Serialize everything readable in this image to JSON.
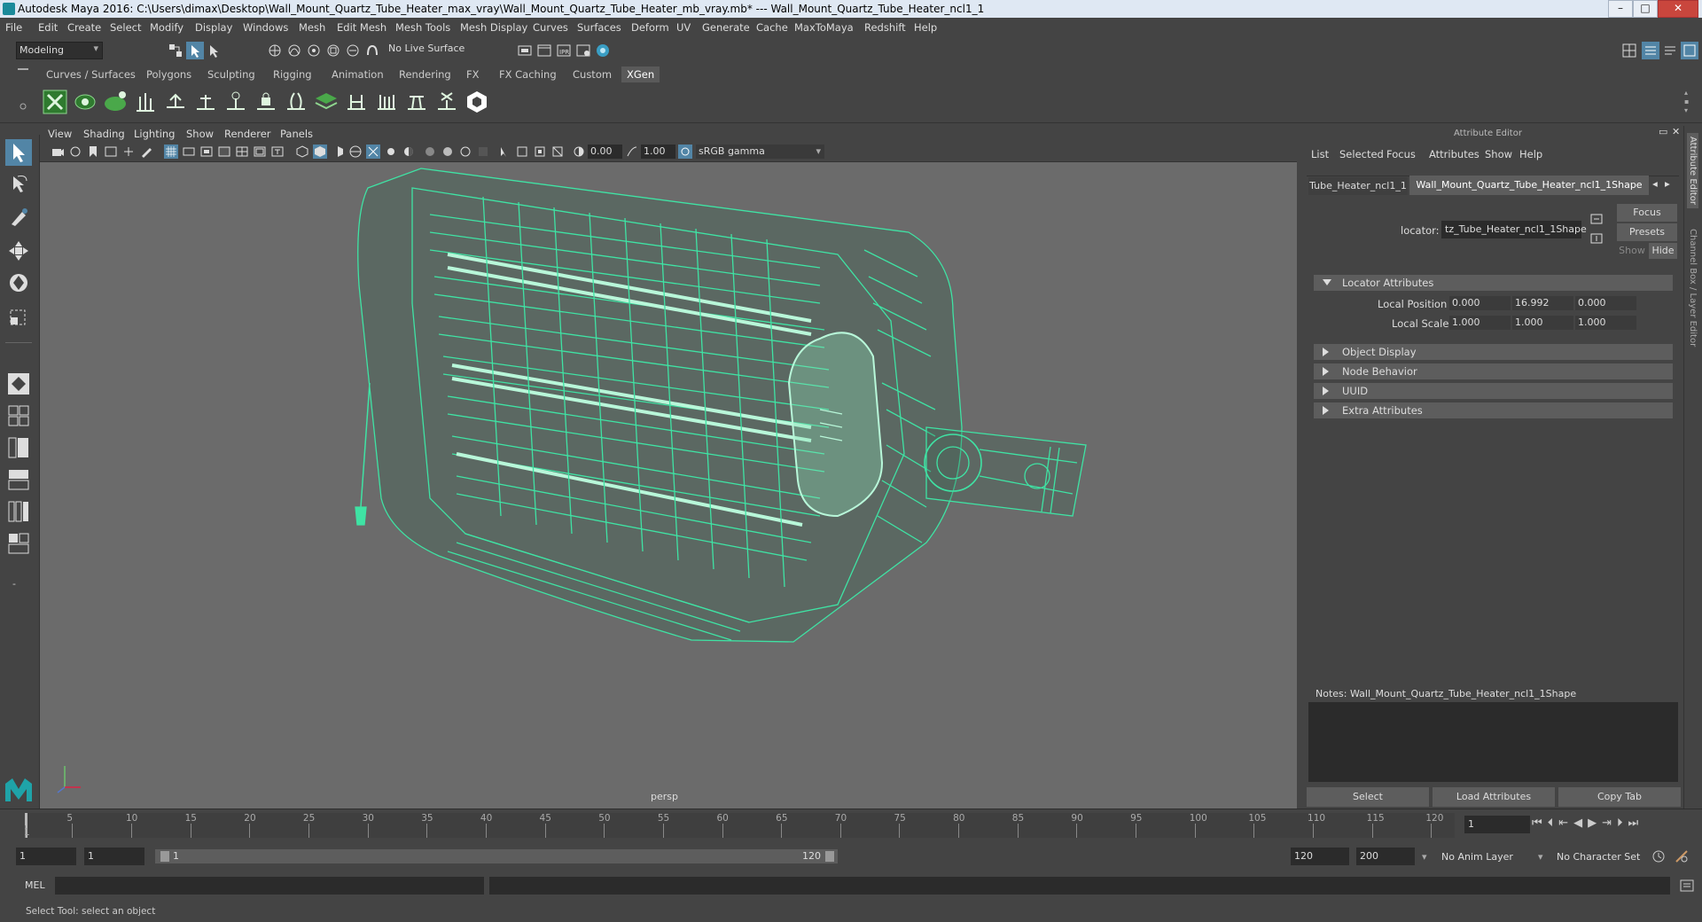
{
  "title": "Autodesk Maya 2016: C:\\Users\\dimax\\Desktop\\Wall_Mount_Quartz_Tube_Heater_max_vray\\Wall_Mount_Quartz_Tube_Heater_mb_vray.mb*   ---   Wall_Mount_Quartz_Tube_Heater_ncl1_1",
  "menubar": [
    "File",
    "Edit",
    "Create",
    "Select",
    "Modify",
    "Display",
    "Windows",
    "Mesh",
    "Edit Mesh",
    "Mesh Tools",
    "Mesh Display",
    "Curves",
    "Surfaces",
    "Deform",
    "UV",
    "Generate",
    "Cache",
    "MaxToMaya",
    "Redshift",
    "Help"
  ],
  "statusline": {
    "mode": "Modeling",
    "live_surface": "No Live Surface"
  },
  "shelf_tabs": [
    "Curves / Surfaces",
    "Polygons",
    "Sculpting",
    "Rigging",
    "Animation",
    "Rendering",
    "FX",
    "FX Caching",
    "Custom",
    "XGen"
  ],
  "viewport": {
    "menu": [
      "View",
      "Shading",
      "Lighting",
      "Show",
      "Renderer",
      "Panels"
    ],
    "exposure": "0.00",
    "gamma": "1.00",
    "colorspace": "sRGB gamma",
    "camera": "persp"
  },
  "attr_editor": {
    "header": "Attribute Editor",
    "menu": [
      "List",
      "Selected",
      "Focus",
      "Attributes",
      "Show",
      "Help"
    ],
    "tab_prev": "Tube_Heater_ncl1_1",
    "tab_active": "Wall_Mount_Quartz_Tube_Heater_ncl1_1Shape",
    "locator_label": "locator:",
    "locator_value": "tz_Tube_Heater_ncl1_1Shape",
    "focus_btn": "Focus",
    "presets_btn": "Presets",
    "show_btn": "Show",
    "hide_btn": "Hide",
    "section_locator": "Locator Attributes",
    "local_position_label": "Local Position",
    "local_position": [
      "0.000",
      "16.992",
      "0.000"
    ],
    "local_scale_label": "Local Scale",
    "local_scale": [
      "1.000",
      "1.000",
      "1.000"
    ],
    "sections": [
      "Object Display",
      "Node Behavior",
      "UUID",
      "Extra Attributes"
    ],
    "notes": "Notes:  Wall_Mount_Quartz_Tube_Heater_ncl1_1Shape",
    "btn_select": "Select",
    "btn_load": "Load Attributes",
    "btn_copy": "Copy Tab"
  },
  "side_tabs": [
    "Attribute Editor",
    "Channel Box / Layer Editor"
  ],
  "timeline": {
    "ticks": [
      "1",
      "5",
      "10",
      "15",
      "20",
      "25",
      "30",
      "35",
      "40",
      "45",
      "50",
      "55",
      "60",
      "65",
      "70",
      "75",
      "80",
      "85",
      "90",
      "95",
      "100",
      "105",
      "110",
      "115",
      "120"
    ],
    "current_frame": "1"
  },
  "range": {
    "start": "1",
    "playback_start": "1",
    "slider_start": "1",
    "slider_end": "120",
    "playback_end": "120",
    "end": "200",
    "anim_layer": "No Anim Layer",
    "char_set": "No Character Set"
  },
  "cmdline": {
    "lang": "MEL"
  },
  "help": "Select Tool: select an object"
}
